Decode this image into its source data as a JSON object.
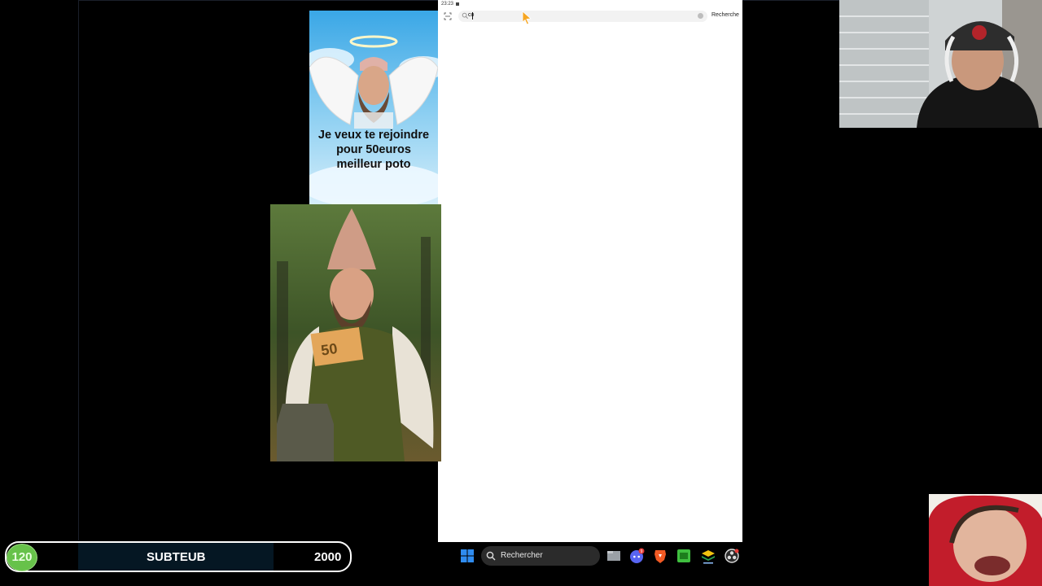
{
  "phone": {
    "status_time": "23:23",
    "search_value": "co",
    "search_button_label": "Recherche"
  },
  "meme_top": {
    "caption_lines": [
      "Je veux te rejoindre",
      "pour 50euros",
      "meilleur poto"
    ]
  },
  "meme_bottom": {
    "banknote_value": "50"
  },
  "sub_goal_bar": {
    "current": "120",
    "label": "SUBTEUB",
    "goal": "2000"
  },
  "taskbar": {
    "search_placeholder": "Rechercher",
    "discord_badge": "9",
    "icons": [
      "windows-start-icon",
      "search-icon",
      "file-explorer-icon",
      "discord-icon",
      "brave-icon",
      "green-app-icon",
      "layers-app-icon",
      "obs-icon"
    ]
  },
  "colors": {
    "sub_green": "#67c24a",
    "windows_blue": "#2f8cf0",
    "brave_orange": "#f25a24"
  }
}
